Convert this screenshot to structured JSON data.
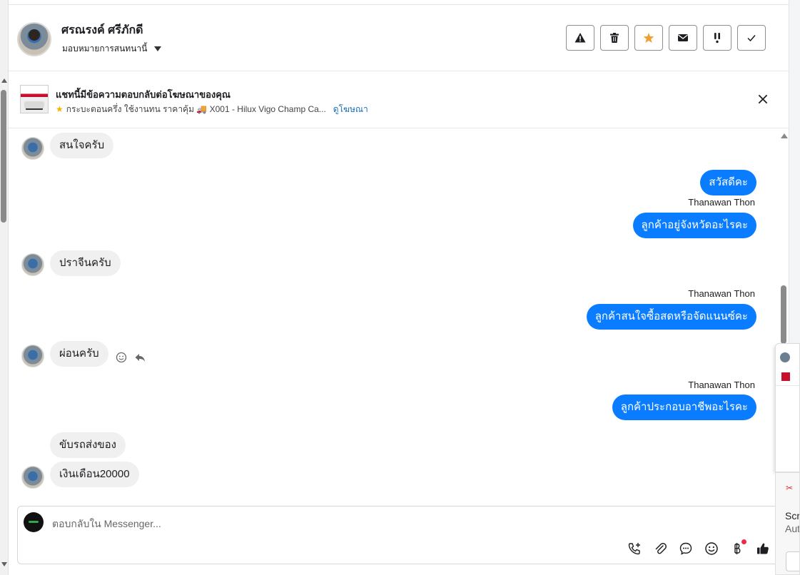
{
  "contact": {
    "name": "ศรณรงค์ ศรีภักดี",
    "assign_label": "มอบหมายการสนทนานี้"
  },
  "header_actions": [
    {
      "name": "spam-button",
      "icon": "warning-icon"
    },
    {
      "name": "delete-button",
      "icon": "trash-icon"
    },
    {
      "name": "star-button",
      "icon": "star-icon",
      "color": "#f0a030"
    },
    {
      "name": "mark-unread-button",
      "icon": "envelope-icon"
    },
    {
      "name": "follow-up-button",
      "icon": "exclamation-icon"
    },
    {
      "name": "mark-done-button",
      "icon": "check-icon"
    }
  ],
  "ad_banner": {
    "title": "แชทนี้มีข้อความตอบกลับต่อโฆษณาของคุณ",
    "description": "กระบะตอนครึ่ง ใช้งานทน ราคาคุ้ม 🚚 X001 - Hilux Vigo Champ Ca...",
    "link": "ดูโฆษณา"
  },
  "messages": {
    "m1": "สนใจครับ",
    "m2": "สวัสดีคะ",
    "sender1": "Thanawan Thon",
    "m3": "ลูกค้าอยู่จังหวัดอะไรคะ",
    "m4": "ปราจีนครับ",
    "sender2": "Thanawan Thon",
    "m5": "ลูกค้าสนใจซื้อสดหรือจัดแนนซ์คะ",
    "m6": "ผ่อนครับ",
    "sender3": "Thanawan Thon",
    "m7": "ลูกค้าประกอบอาชีพอะไรคะ",
    "m8": "ขับรถส่งของ",
    "m9": "เงินเดือน20000"
  },
  "composer": {
    "placeholder": "ตอบกลับใน Messenger..."
  },
  "colors": {
    "outgoing_bubble": "#0a7cff",
    "incoming_bubble": "#f0f0f0",
    "link": "#1a6fb5"
  },
  "side_window": {
    "title": "Scre",
    "subtitle": "Aut"
  }
}
